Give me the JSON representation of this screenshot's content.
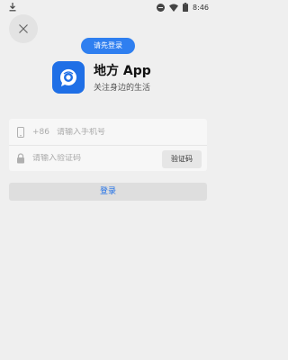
{
  "status_bar": {
    "time": "8:46",
    "icons": [
      "download-icon",
      "do-not-disturb-icon",
      "wifi-icon",
      "battery-icon"
    ]
  },
  "close_button": {
    "icon": "close-icon",
    "glyph": "×"
  },
  "badge": {
    "label": "请先登录"
  },
  "app": {
    "name": "地方 App",
    "slogan": "关注身边的生活",
    "logo_icon": "app-logo-icon"
  },
  "form": {
    "phone": {
      "icon": "phone-icon",
      "country_code": "+86",
      "placeholder": "请输入手机号",
      "value": ""
    },
    "code": {
      "icon": "lock-icon",
      "placeholder": "请输入验证码",
      "value": "",
      "get_code_label": "验证码"
    }
  },
  "login_button": {
    "label": "登录"
  },
  "colors": {
    "accent": "#2f7ff0",
    "logo_bg": "#1f6fe6",
    "background": "#efefef",
    "card": "#f7f7f7",
    "button_bg": "#dedede"
  }
}
